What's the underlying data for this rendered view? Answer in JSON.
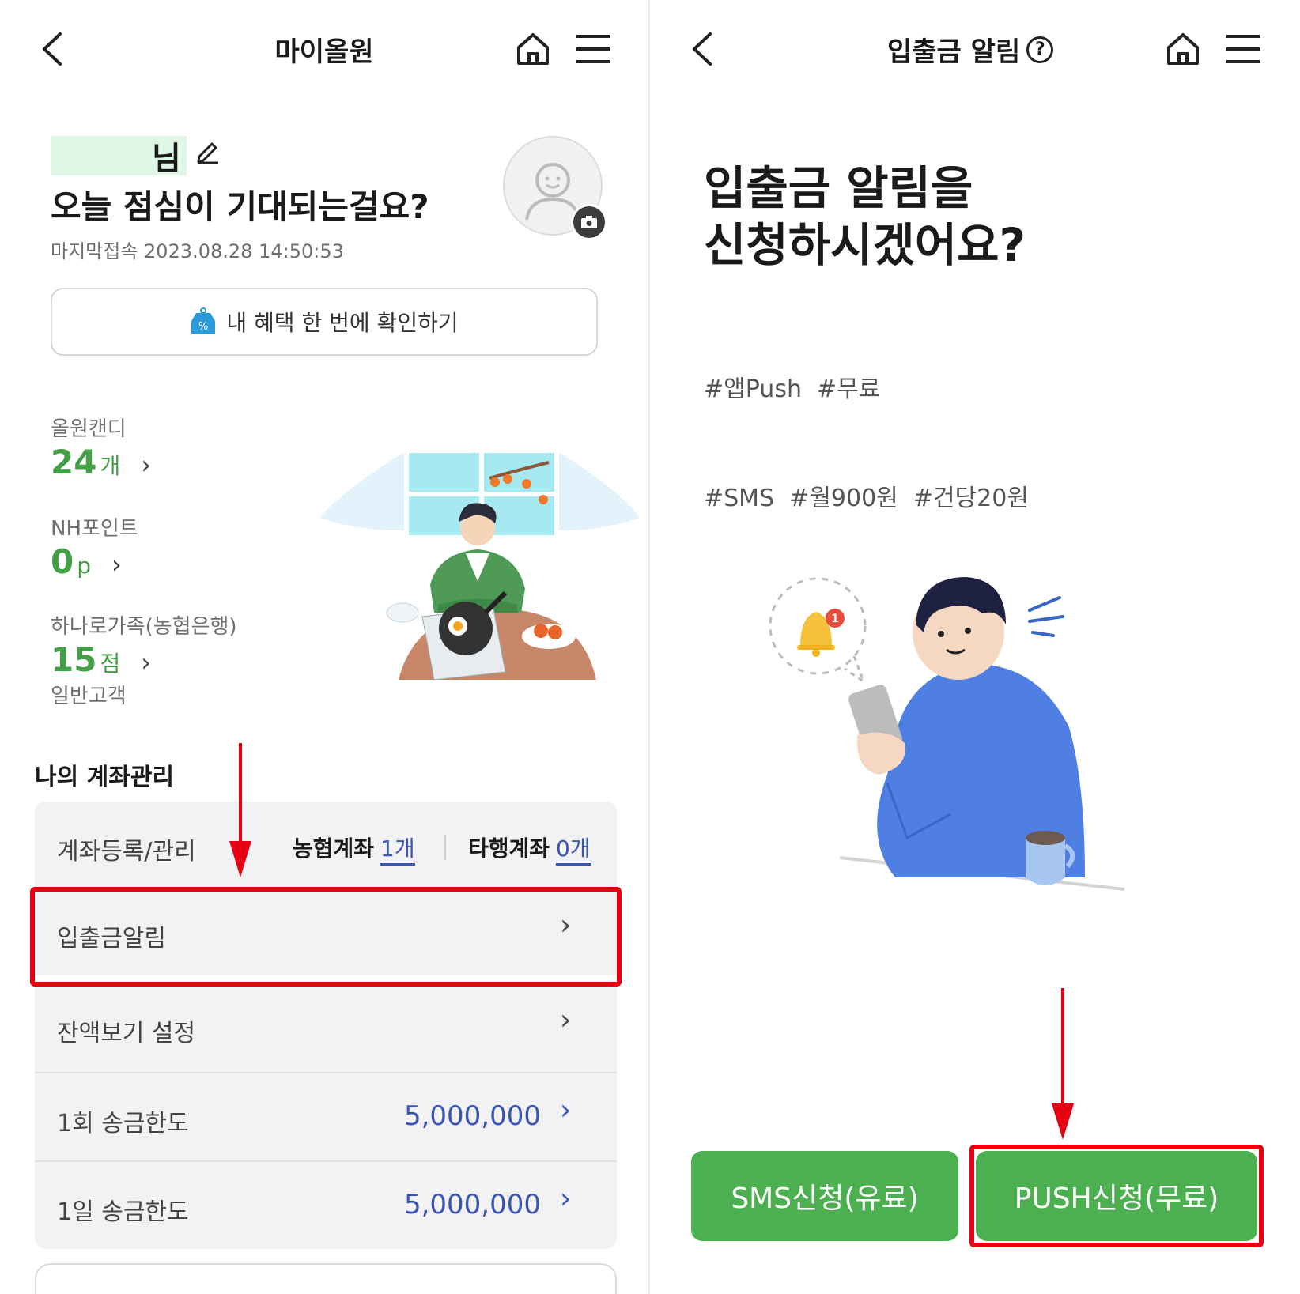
{
  "left": {
    "header": {
      "title": "마이올원",
      "back_icon": "chevron-left-icon",
      "home_icon": "home-icon",
      "menu_icon": "hamburger-menu-icon"
    },
    "profile": {
      "name_suffix": "님",
      "greeting": "오늘 점심이 기대되는걸요?",
      "last_access": "마지막접속 2023.08.28 14:50:53",
      "name_mask_color": "#e0f7e6"
    },
    "benefit_button": {
      "label": "내 혜택 한 번에 확인하기",
      "icon": "price-tag-icon"
    },
    "stats": [
      {
        "label": "올원캔디",
        "value": "24",
        "unit": "개"
      },
      {
        "label": "NH포인트",
        "value": "0",
        "unit": "p"
      },
      {
        "label": "하나로가족(농협은행)",
        "value": "15",
        "unit": "점",
        "sub": "일반고객"
      }
    ],
    "account_section": {
      "title": "나의 계좌관리",
      "register_label": "계좌등록/관리",
      "nh_label": "농협계좌",
      "nh_count": "1개",
      "other_label": "타행계좌",
      "other_count": "0개",
      "rows": [
        {
          "label": "입출금알림",
          "value": ""
        },
        {
          "label": "잔액보기 설정",
          "value": ""
        },
        {
          "label": "1회 송금한도",
          "value": "5,000,000"
        },
        {
          "label": "1일 송금한도",
          "value": "5,000,000"
        }
      ]
    }
  },
  "right": {
    "header": {
      "title": "입출금 알림",
      "help_icon": "question-circle-icon",
      "back_icon": "chevron-left-icon",
      "home_icon": "home-icon",
      "menu_icon": "hamburger-menu-icon"
    },
    "headline_line1": "입출금 알림을",
    "headline_line2": "신청하시겠어요?",
    "tags_line1": "#앱Push  #무료",
    "tags_line2": "#SMS  #월900원  #건당20원",
    "notification_badge": "1",
    "buttons": {
      "sms": "SMS신청(유료)",
      "push": "PUSH신청(무료)"
    }
  },
  "colors": {
    "accent_green": "#4caf50",
    "value_green": "#43a047",
    "value_blue": "#3a56b0",
    "highlight_red": "#e60012"
  }
}
